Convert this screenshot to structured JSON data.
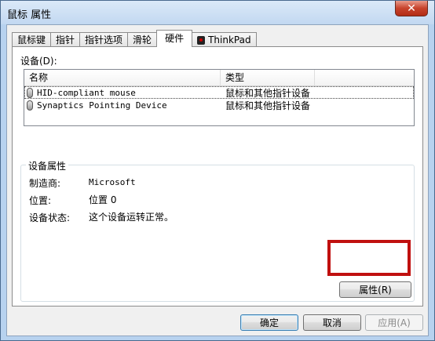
{
  "window": {
    "title": "鼠标 属性",
    "close_label": "✕"
  },
  "tabs": [
    {
      "label": "鼠标键"
    },
    {
      "label": "指针"
    },
    {
      "label": "指针选项"
    },
    {
      "label": "滑轮"
    },
    {
      "label": "硬件"
    },
    {
      "label": "ThinkPad"
    }
  ],
  "active_tab": "硬件",
  "devices": {
    "label": "设备(D):",
    "columns": {
      "name": "名称",
      "type": "类型"
    },
    "rows": [
      {
        "name": "HID-compliant mouse",
        "type": "鼠标和其他指针设备",
        "selected": true
      },
      {
        "name": "Synaptics Pointing Device",
        "type": "鼠标和其他指针设备",
        "selected": false
      }
    ]
  },
  "properties": {
    "group_title": "设备属性",
    "manufacturer_label": "制造商:",
    "manufacturer_value": "Microsoft",
    "location_label": "位置:",
    "location_value": "位置 0",
    "status_label": "设备状态:",
    "status_value": "这个设备运转正常。"
  },
  "buttons": {
    "properties": "属性(R)",
    "ok": "确定",
    "cancel": "取消",
    "apply": "应用(A)"
  },
  "colors": {
    "highlight": "#c0100f",
    "titlebar": "#c2d8f1"
  }
}
